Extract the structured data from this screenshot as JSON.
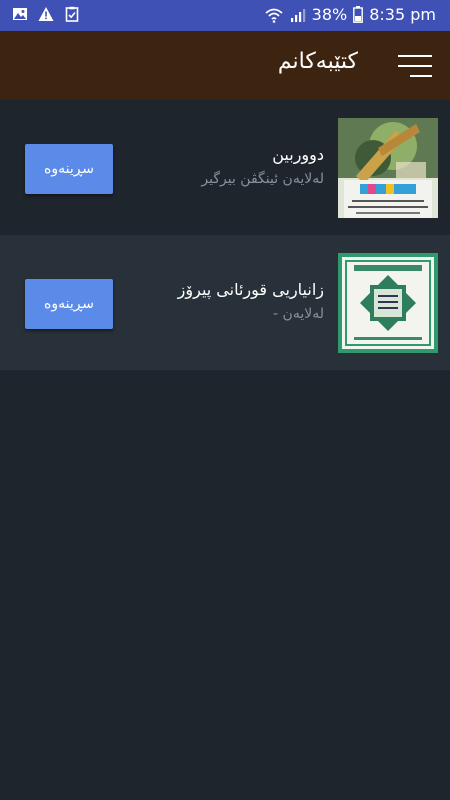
{
  "status_bar": {
    "battery": "38%",
    "time": "8:35 pm",
    "left_icons": [
      "image-icon",
      "warning-icon",
      "clipboard-check-icon"
    ],
    "right_icons": [
      "wifi-icon",
      "signal-icon",
      "battery-icon"
    ]
  },
  "toolbar": {
    "title": "کتێبەکانم",
    "menu_icon": "menu-icon",
    "background": "#3d2410"
  },
  "books": [
    {
      "title": "دووربین",
      "author": "لەلایەن ئینگڤن بیرگیر",
      "button_label": "سڕینەوە"
    },
    {
      "title": "زانیاریی قورئانی پیرۆز",
      "author": "لەلایەن -",
      "button_label": "سڕینەوە"
    }
  ],
  "colors": {
    "status_bar": "#3f51b5",
    "background": "#1f252d",
    "alt_row": "#283039",
    "button": "#5b8be8"
  }
}
